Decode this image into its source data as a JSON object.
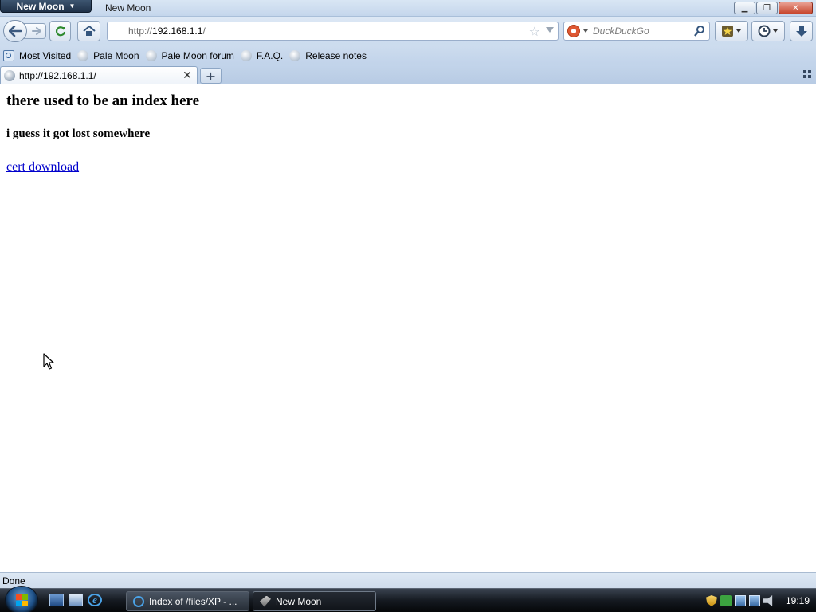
{
  "window": {
    "app_menu_label": "New Moon",
    "title": "New Moon"
  },
  "navbar": {
    "url_scheme": "http://",
    "url_host": "192.168.1.1",
    "url_path": "/",
    "search_placeholder": "DuckDuckGo"
  },
  "bookmarks": [
    {
      "label": "Most Visited",
      "icon": "most-visited-icon"
    },
    {
      "label": "Pale Moon",
      "icon": "globe-icon"
    },
    {
      "label": "Pale Moon forum",
      "icon": "globe-icon"
    },
    {
      "label": "F.A.Q.",
      "icon": "globe-icon"
    },
    {
      "label": "Release notes",
      "icon": "globe-icon"
    }
  ],
  "tabs": [
    {
      "label": "http://192.168.1.1/",
      "active": true
    }
  ],
  "page": {
    "heading": "there used to be an index here",
    "subheading": "i guess it got lost somewhere",
    "link_text": "cert download"
  },
  "status": {
    "text": "Done"
  },
  "taskbar": {
    "tasks": [
      {
        "label": "Index of /files/XP - ...",
        "icon": "ie-icon",
        "active": false
      },
      {
        "label": "New Moon",
        "icon": "new-moon-icon",
        "active": true
      }
    ],
    "clock": "19:19"
  },
  "colors": {
    "link": "#0000cc",
    "chrome_blue": "#c4d6ec",
    "taskbar": "#151a21"
  }
}
